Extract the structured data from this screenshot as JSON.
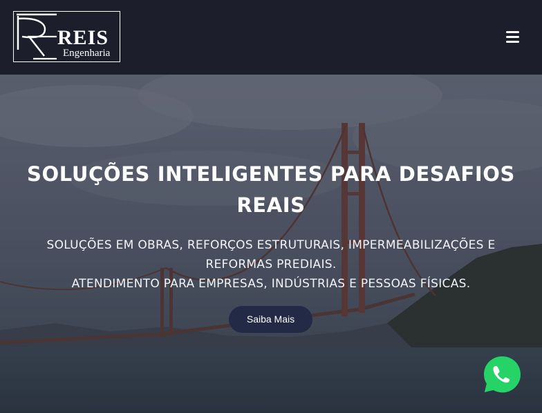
{
  "header": {
    "logo": {
      "monogram": "RE",
      "name": "REIS",
      "subtitle": "Engenharia"
    },
    "menu_icon": "hamburger-menu-icon"
  },
  "hero": {
    "title": "SOLUÇÕES INTELIGENTES PARA DESAFIOS REAIS",
    "subtitle_line1": "SOLUÇÕES EM OBRAS, REFORÇOS ESTRUTURAIS, IMPERMEABILIZAÇÕES E REFORMAS PREDIAIS.",
    "subtitle_line2": "ATENDIMENTO PARA EMPRESAS, INDÚSTRIAS E PESSOAS FÍSICAS.",
    "cta_label": "Saiba Mais",
    "background": "golden-gate-bridge-photo"
  },
  "floating": {
    "whatsapp_icon": "whatsapp-phone-icon",
    "whatsapp_color": "#25d366"
  },
  "colors": {
    "header_bg": "#1c1f2b",
    "cta_bg": "#232a46",
    "text": "#ffffff"
  }
}
